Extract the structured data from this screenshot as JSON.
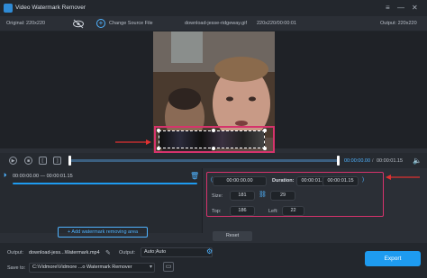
{
  "app": {
    "title": "Video Watermark Remover"
  },
  "infobar": {
    "original": "Original: 220x220",
    "change_source": "Change Source File",
    "filename": "download-jesse-ridgeway.gif",
    "filemeta": "220x220/00:00:01",
    "output": "Output: 220x220"
  },
  "timeline": {
    "left_time": "00:00:00.00",
    "right_time": "00:00:01.15",
    "progress": 0.0
  },
  "segment": {
    "label": "00:00:00.00 — 00:00:01.15"
  },
  "add_area": {
    "label": "Add watermark removing area"
  },
  "settings": {
    "start": "00:00:00.00",
    "duration_label": "Duration:",
    "duration": "00:00:01.15",
    "end": "00:00:01.15",
    "size_label": "Size:",
    "width": "181",
    "height": "29",
    "top_label": "Top:",
    "top": "186",
    "left_label": "Left:",
    "left": "22",
    "reset": "Reset"
  },
  "output": {
    "label": "Output:",
    "filename": "download-jess...Watermark.mp4",
    "format_label": "Output:",
    "format_value": "Auto;Auto",
    "save_label": "Save to:",
    "save_path": "C:\\Vidmore\\Vidmore ...o Watermark Remover",
    "export": "Export"
  },
  "colors": {
    "accent": "#1e9bf0",
    "highlight": "#d6336c",
    "time_text": "#4fb3ff"
  },
  "icons": [
    "video-app-icon",
    "eye-slash-icon",
    "plus-circle-icon",
    "play-icon",
    "stop-icon",
    "prev-frame-icon",
    "next-frame-icon",
    "speaker-icon",
    "trash-icon",
    "gear-icon",
    "folder-icon",
    "link-icon",
    "arrow-left-icon"
  ]
}
